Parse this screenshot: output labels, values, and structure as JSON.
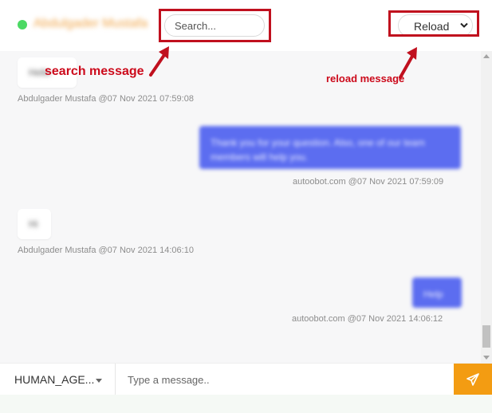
{
  "header": {
    "chat_name": "Abdulgader Mustafa",
    "status": "online",
    "search": {
      "placeholder": "Search..."
    },
    "reload": {
      "label": "Reload"
    }
  },
  "messages": [
    {
      "side": "incoming",
      "text": "Hello",
      "sender": "Abdulgader Mustafa",
      "timestamp": "@07 Nov 2021 07:59:08"
    },
    {
      "side": "outgoing",
      "text": "Thank you for your question. Also, one of our team members will help you.",
      "sender": "autoobot.com",
      "timestamp": "@07 Nov 2021 07:59:09"
    },
    {
      "side": "incoming",
      "text": "Hi",
      "sender": "Abdulgader Mustafa",
      "timestamp": "@07 Nov 2021 14:06:10"
    },
    {
      "side": "outgoing",
      "text": "Help",
      "sender": "autoobot.com",
      "timestamp": "@07 Nov 2021 14:06:12"
    }
  ],
  "composer": {
    "agent_label": "HUMAN_AGE...",
    "message_placeholder": "Type a message..",
    "send_icon": "paper-plane-icon"
  },
  "annotations": {
    "search": "search message",
    "reload": "reload message",
    "color": "#cc0a1b"
  },
  "colors": {
    "accent": "#f39c12",
    "outgoing_bubble": "#5c6df0",
    "status_online": "#4cd964"
  }
}
